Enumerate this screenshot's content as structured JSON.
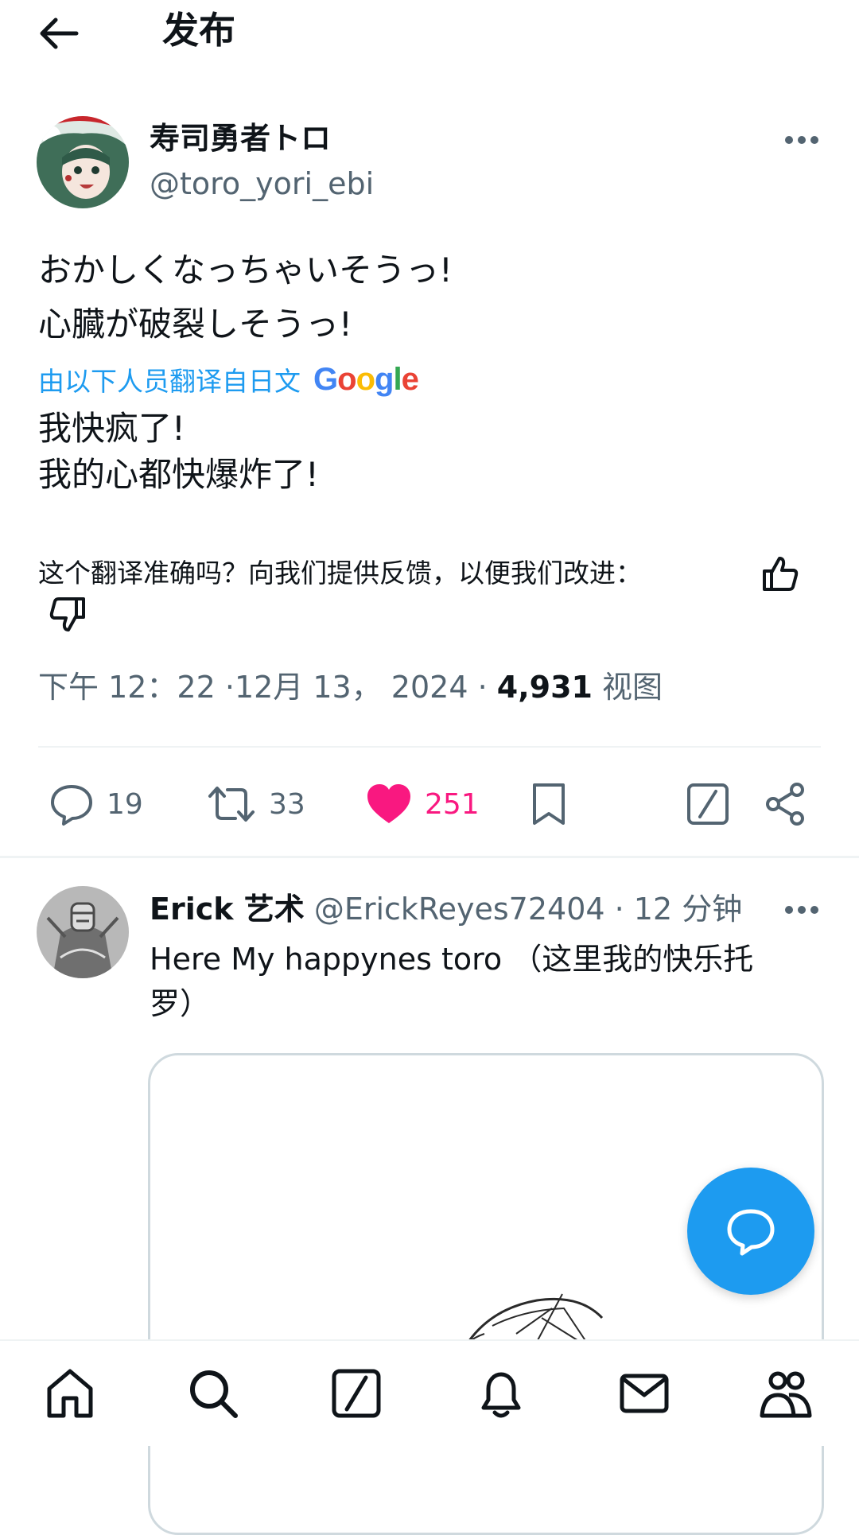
{
  "header": {
    "title": "发布",
    "back_icon": "arrow-left-icon"
  },
  "post": {
    "author_name": "寿司勇者トロ",
    "author_handle": "@toro_yori_ebi",
    "text_lines": [
      "おかしくなっちゃいそうっ!",
      "心臓が破裂しそうっ!"
    ],
    "translated_by_label": "由以下人员翻译自日文",
    "translation_provider": "Google",
    "translated_lines": [
      "我快疯了!",
      "我的心都快爆炸了!"
    ],
    "feedback_prompt": "这个翻译准确吗？向我们提供反馈，以便我们改进：",
    "timestamp": "下午 12：22 ·12月 13， 2024 · ",
    "views_count": "4,931",
    "views_label": " 视图",
    "replies": "19",
    "retweets": "33",
    "likes": "251"
  },
  "reply": {
    "name": "Erick 艺术",
    "meta": " @ErickReyes72404 · 12 分钟",
    "text_lines": [
      "Here My happynes toro （这里我的快乐托",
      "罗）"
    ]
  },
  "colors": {
    "accent": "#1d9bf0",
    "like": "#f91880",
    "secondary_text": "#536471",
    "primary_text": "#0f1419"
  },
  "bottom_nav": [
    "home-icon",
    "search-icon",
    "grok-icon",
    "notifications-icon",
    "messages-icon",
    "communities-icon"
  ]
}
